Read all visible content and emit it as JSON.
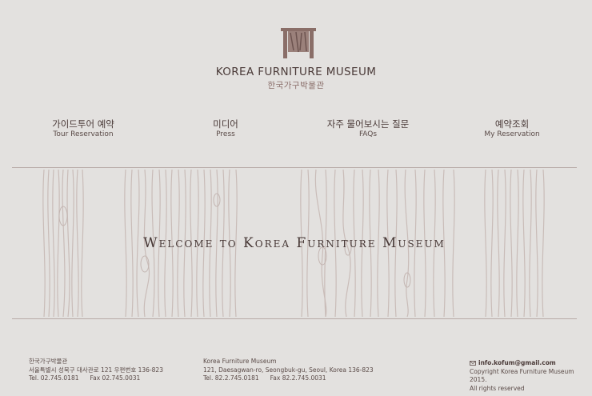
{
  "header": {
    "logo_icon": "furniture-logo-icon",
    "title_en": "KOREA FURNITURE MUSEUM",
    "title_ko": "한국가구박물관"
  },
  "nav": {
    "items": [
      {
        "label_ko": "가이드투어 예약",
        "label_en": "Tour Reservation"
      },
      {
        "label_ko": "미디어",
        "label_en": "Press"
      },
      {
        "label_ko": "자주 물어보시는 질문",
        "label_en": "FAQs"
      },
      {
        "label_ko": "예약조회",
        "label_en": "My Reservation"
      }
    ]
  },
  "hero": {
    "title": "Welcome to Korea Furniture Museum"
  },
  "footer": {
    "korean": {
      "name": "한국가구박물관",
      "address": "서울특별시 성북구 대사관로 121 우편번호 136-823",
      "tel": "Tel. 02.745.0181",
      "fax": "Fax 02.745.0031"
    },
    "english": {
      "name": "Korea Furniture Museum",
      "address": "121, Daesagwan-ro, Seongbuk-gu, Seoul, Korea 136-823",
      "tel": "Tel. 82.2.745.0181",
      "fax": "Fax 82.2.745.0031"
    },
    "contact": {
      "mail_icon": "mail-icon",
      "email": "info.kofum@gmail.com",
      "copyright": "Copyright Korea Furniture Museum 2015.",
      "rights": "All rights reserved"
    }
  },
  "colors": {
    "background": "#e3e1df",
    "text": "#4a3a38",
    "accent": "#8a6e6a"
  }
}
